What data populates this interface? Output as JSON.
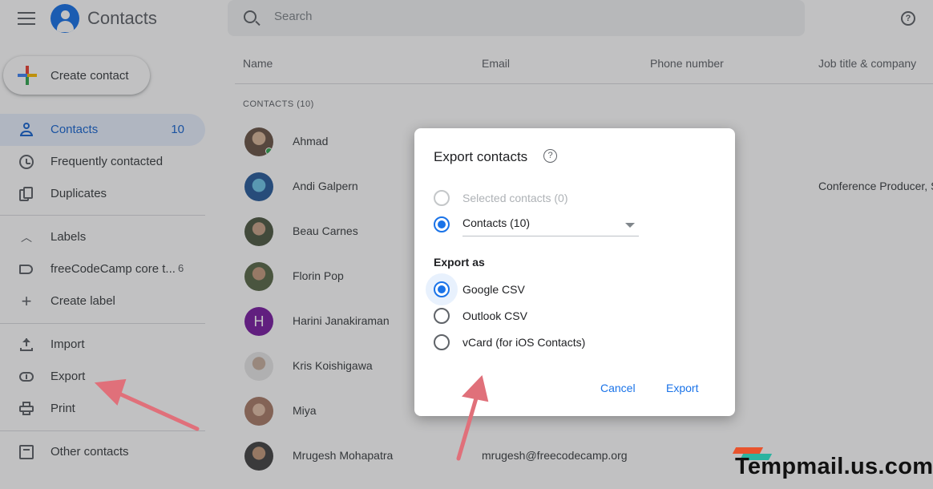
{
  "header": {
    "app_title": "Contacts",
    "search_placeholder": "Search"
  },
  "sidebar": {
    "create_label": "Create contact",
    "items": [
      {
        "label": "Contacts",
        "count": "10",
        "icon": "person-icon"
      },
      {
        "label": "Frequently contacted",
        "icon": "history-icon"
      },
      {
        "label": "Duplicates",
        "icon": "duplicate-icon"
      }
    ],
    "labels_header": "Labels",
    "labels": [
      {
        "label": "freeCodeCamp core t...",
        "count": "6"
      }
    ],
    "create_label_link": "Create label",
    "actions": [
      {
        "label": "Import",
        "icon": "upload-icon"
      },
      {
        "label": "Export",
        "icon": "cloud-download-icon"
      },
      {
        "label": "Print",
        "icon": "print-icon"
      }
    ],
    "other_contacts": "Other contacts"
  },
  "list": {
    "columns": [
      "Name",
      "Email",
      "Phone number",
      "Job title & company"
    ],
    "section_label": "CONTACTS (10)",
    "rows": [
      {
        "name": "Ahmad",
        "email": "",
        "job": "",
        "avatar": "photo",
        "online": true
      },
      {
        "name": "Andi Galpern",
        "email": "",
        "job": "Conference Producer, S",
        "avatar": "photo"
      },
      {
        "name": "Beau Carnes",
        "email": "",
        "job": "",
        "avatar": "photo"
      },
      {
        "name": "Florin Pop",
        "email": "",
        "job": "",
        "avatar": "photo"
      },
      {
        "name": "Harini Janakiraman",
        "email": "",
        "job": "",
        "avatar": "letter",
        "initial": "H"
      },
      {
        "name": "Kris Koishigawa",
        "email": "",
        "job": "",
        "avatar": "photo"
      },
      {
        "name": "Miya",
        "email": "",
        "job": "",
        "avatar": "photo"
      },
      {
        "name": "Mrugesh Mohapatra",
        "email": "mrugesh@freecodecamp.org",
        "job": "",
        "avatar": "photo"
      }
    ]
  },
  "dialog": {
    "title": "Export contacts",
    "scope_options": [
      {
        "label": "Selected contacts (0)",
        "state": "disabled"
      },
      {
        "label": "Contacts (10)",
        "state": "checked"
      }
    ],
    "export_as_label": "Export as",
    "format_options": [
      {
        "label": "Google CSV",
        "state": "checked"
      },
      {
        "label": "Outlook CSV",
        "state": "unchecked"
      },
      {
        "label": "vCard (for iOS Contacts)",
        "state": "unchecked"
      }
    ],
    "cancel_label": "Cancel",
    "export_label": "Export"
  },
  "watermark": "Tempmail.us.com",
  "colors": {
    "accent": "#1a73e8",
    "active_bg": "#e8f0fe",
    "arrow": "#e0707a"
  }
}
